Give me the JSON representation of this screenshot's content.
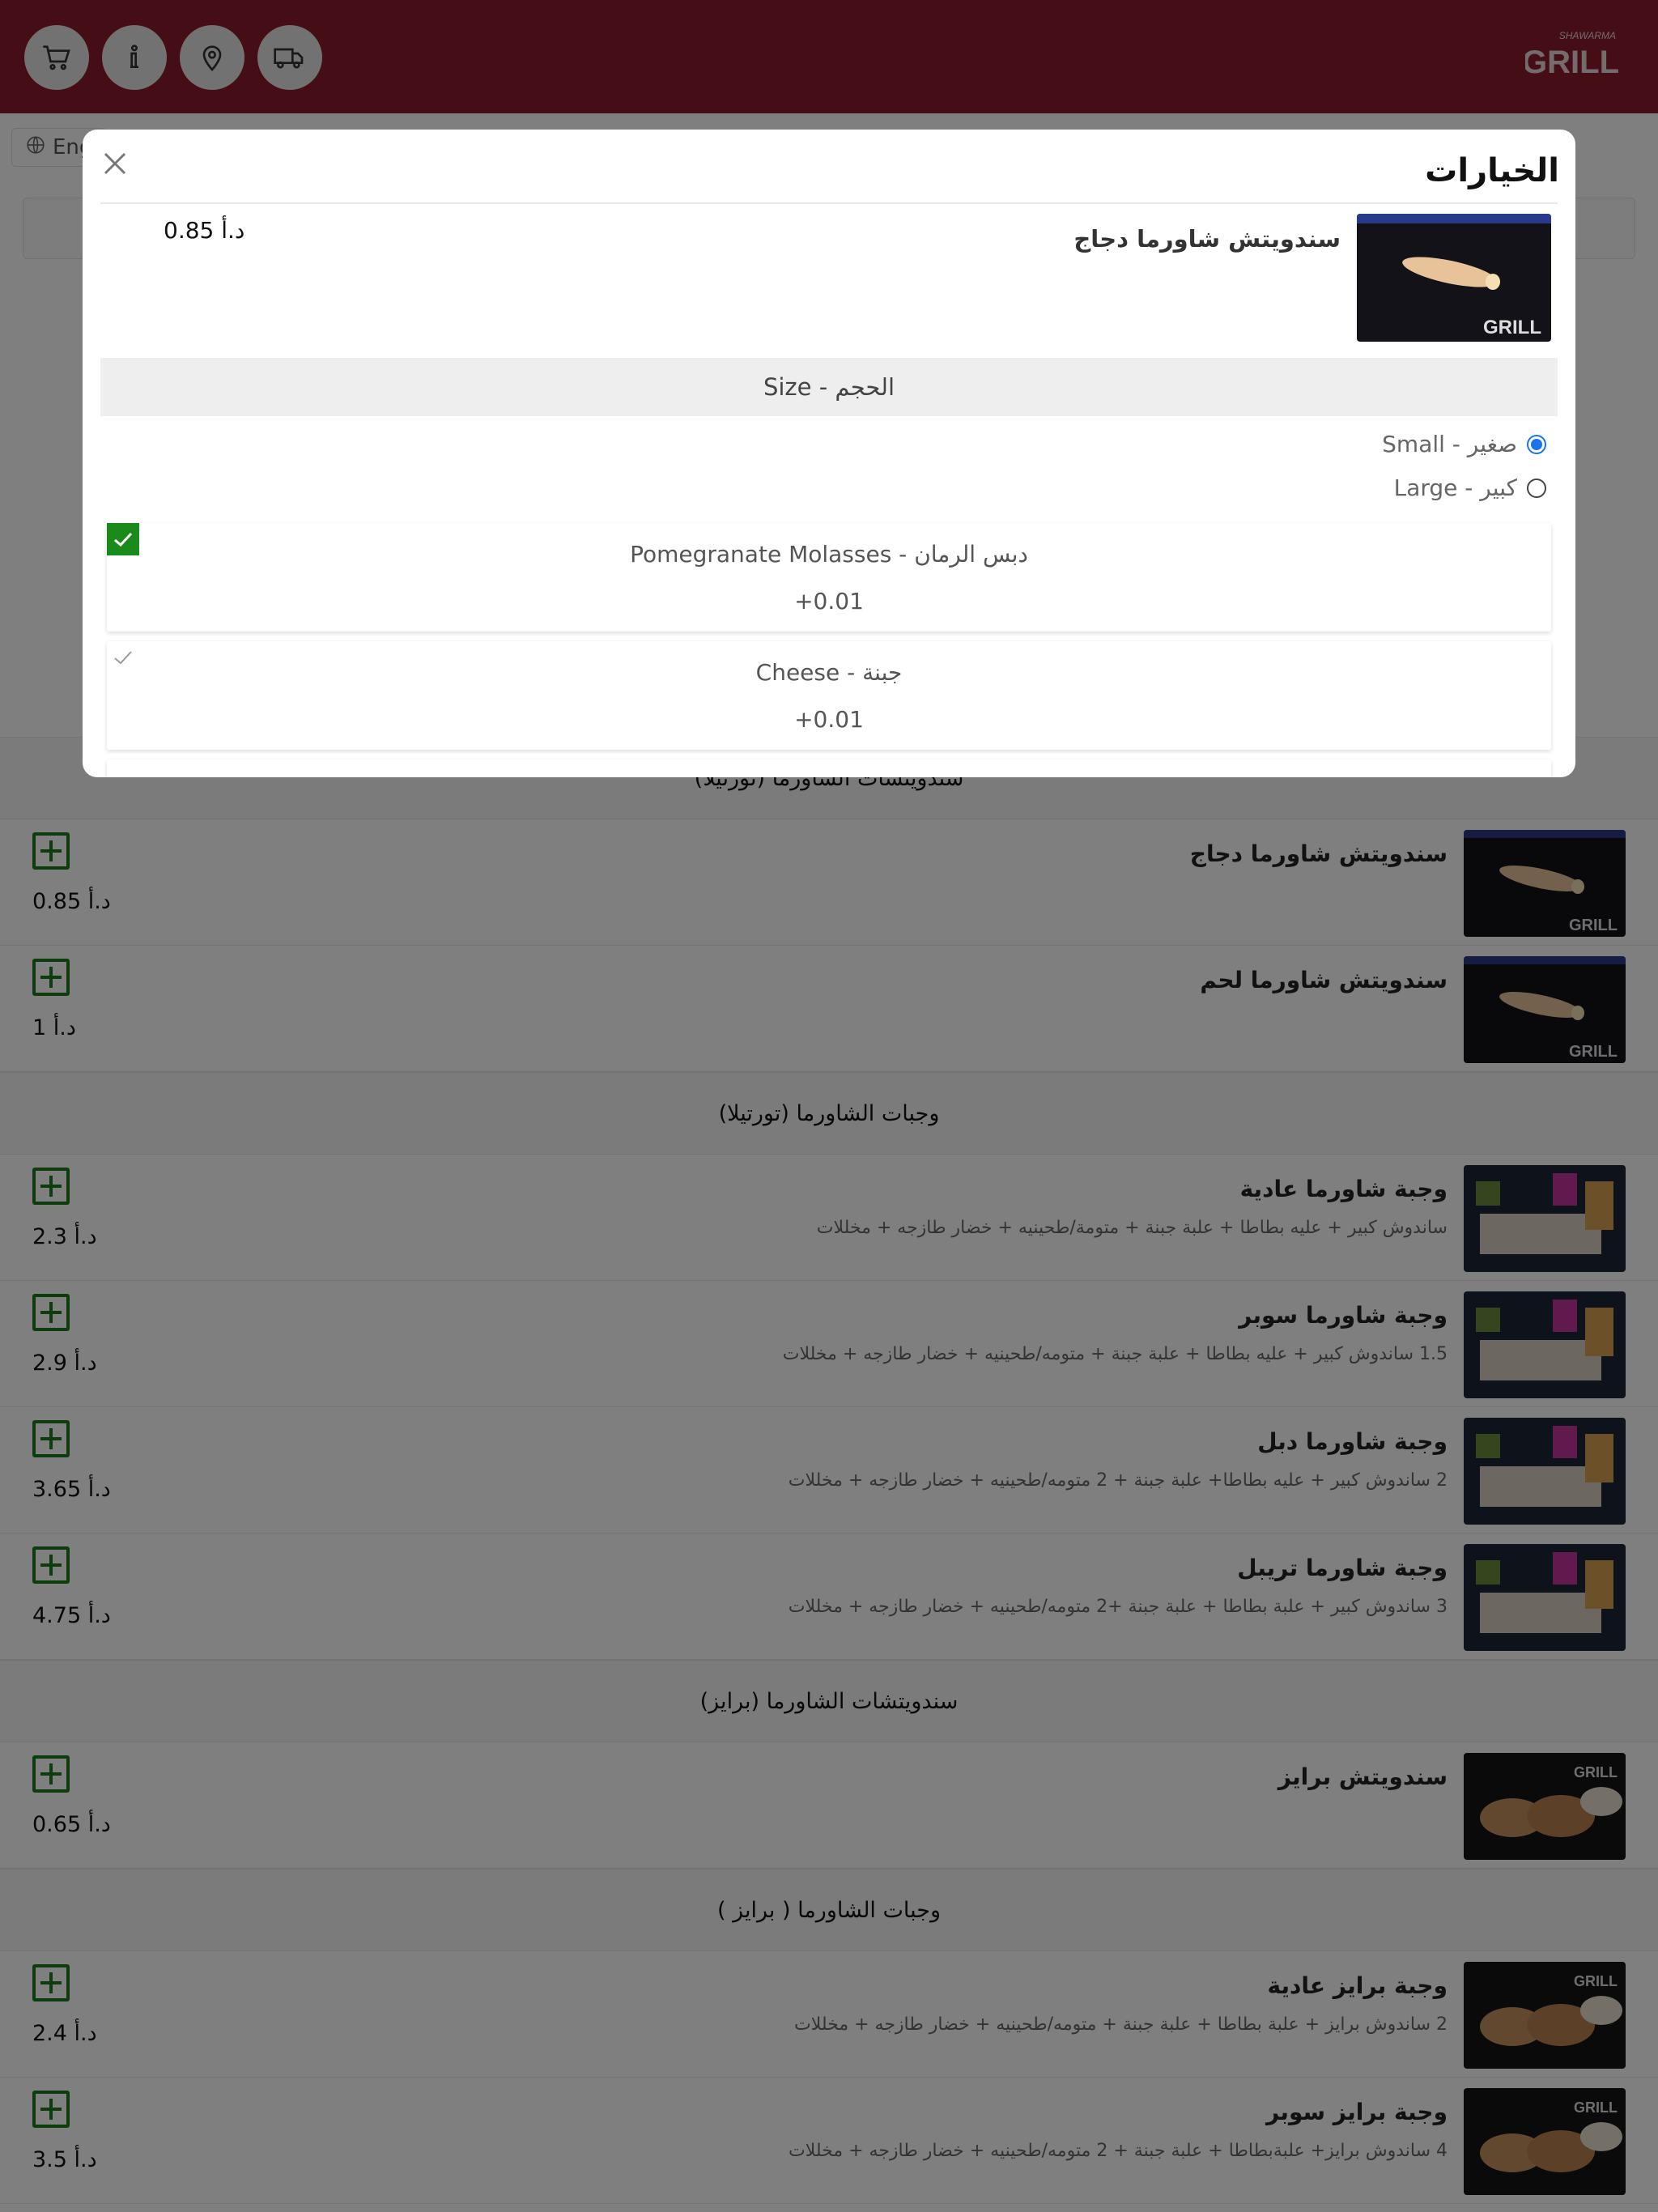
{
  "header": {
    "icons": [
      "cart-icon",
      "info-icon",
      "location-icon",
      "delivery-truck-icon"
    ],
    "logo_top": "SHAWARMA",
    "logo_main": "GRILL"
  },
  "language": {
    "label": "Eng"
  },
  "menu": {
    "sections": [
      {
        "title": "سندويتشات الشاورما (تورتيلا)",
        "items": [
          {
            "name": "سندويتش شاورما دجاج",
            "desc": "",
            "price": "0.85 د.أ"
          },
          {
            "name": "سندويتش شاورما لحم",
            "desc": "",
            "price": "1 د.أ"
          }
        ]
      },
      {
        "title": "وجبات الشاورما (تورتيلا)",
        "items": [
          {
            "name": "وجبة شاورما عادية",
            "desc": "ساندوش كبير + عليه بطاطا + علبة جبنة + متومة/طحينيه + خضار طازجه + مخللات",
            "price": "2.3 د.أ"
          },
          {
            "name": "وجبة شاورما سوبر",
            "desc": "1.5 ساندوش كبير + عليه بطاطا + علبة جبنة + متومه/طحينيه + خضار طازجه + مخللات",
            "price": "2.9 د.أ"
          },
          {
            "name": "وجبة شاورما دبل",
            "desc": "2 ساندوش كبير + عليه بطاطا+ علبة جبنة + 2 متومه/طحينيه + خضار طازجه + مخللات",
            "price": "3.65 د.أ"
          },
          {
            "name": "وجبة شاورما تريبل",
            "desc": "3 ساندوش كبير + علبة بطاطا + علبة جبنة +2 متومه/طحينيه + خضار طازجه + مخللات",
            "price": "4.75 د.أ"
          }
        ]
      },
      {
        "title": "سندويتشات الشاورما (برايز)",
        "items": [
          {
            "name": "سندويتش برايز",
            "desc": "",
            "price": "0.65 د.أ"
          }
        ]
      },
      {
        "title": "وجبات الشاورما ( برايز )",
        "items": [
          {
            "name": "وجبة برايز عادية",
            "desc": "2 ساندوش برايز + علبة بطاطا + علبة جبنة + متومه/طحينيه + خضار طازجه + مخللات",
            "price": "2.4 د.أ"
          },
          {
            "name": "وجبة برايز سوبر",
            "desc": "4 ساندوش برايز+ علبةبطاطا + علبة جبنة + 2 متومه/طحينيه + خضار طازجه + مخللات",
            "price": "3.5 د.أ"
          }
        ]
      }
    ]
  },
  "modal": {
    "title": "الخيارات",
    "product_name": "سندويتش شاورما دجاج",
    "product_price": "0.85 د.أ",
    "size_heading": "الحجم - Size",
    "sizes": [
      {
        "label": "صغير - Small",
        "selected": true
      },
      {
        "label": "كبير - Large",
        "selected": false
      }
    ],
    "addons": [
      {
        "name": "Pomegranate Molasses - دبس الرمان",
        "price": "+0.01",
        "checked": true
      },
      {
        "name": "Cheese - جبنة",
        "price": "+0.01",
        "checked": false
      }
    ]
  },
  "colors": {
    "header_bg": "#8b1a2a",
    "accent_green": "#1a8a1a",
    "radio_blue": "#1a73e8"
  }
}
